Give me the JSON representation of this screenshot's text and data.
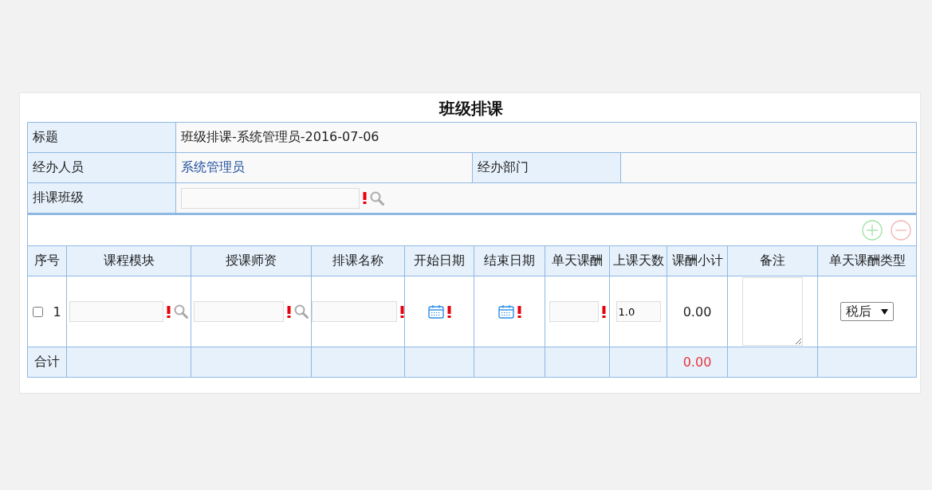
{
  "title": "班级排课",
  "form": {
    "title_label": "标题",
    "title_value": "班级排课-系统管理员-2016-07-06",
    "handler_label": "经办人员",
    "handler_value": "系统管理员",
    "dept_label": "经办部门",
    "class_label": "排课班级"
  },
  "columns": [
    "序号",
    "课程模块",
    "授课师资",
    "排课名称",
    "开始日期",
    "结束日期",
    "单天课酬",
    "上课天数",
    "课酬小计",
    "备注",
    "单天课酬类型"
  ],
  "rows": [
    {
      "checked": false,
      "index": "1",
      "days": "1.0",
      "subtotal": "0.00",
      "pay_type": "税后"
    }
  ],
  "total": {
    "label": "合计",
    "subtotal": "0.00"
  }
}
